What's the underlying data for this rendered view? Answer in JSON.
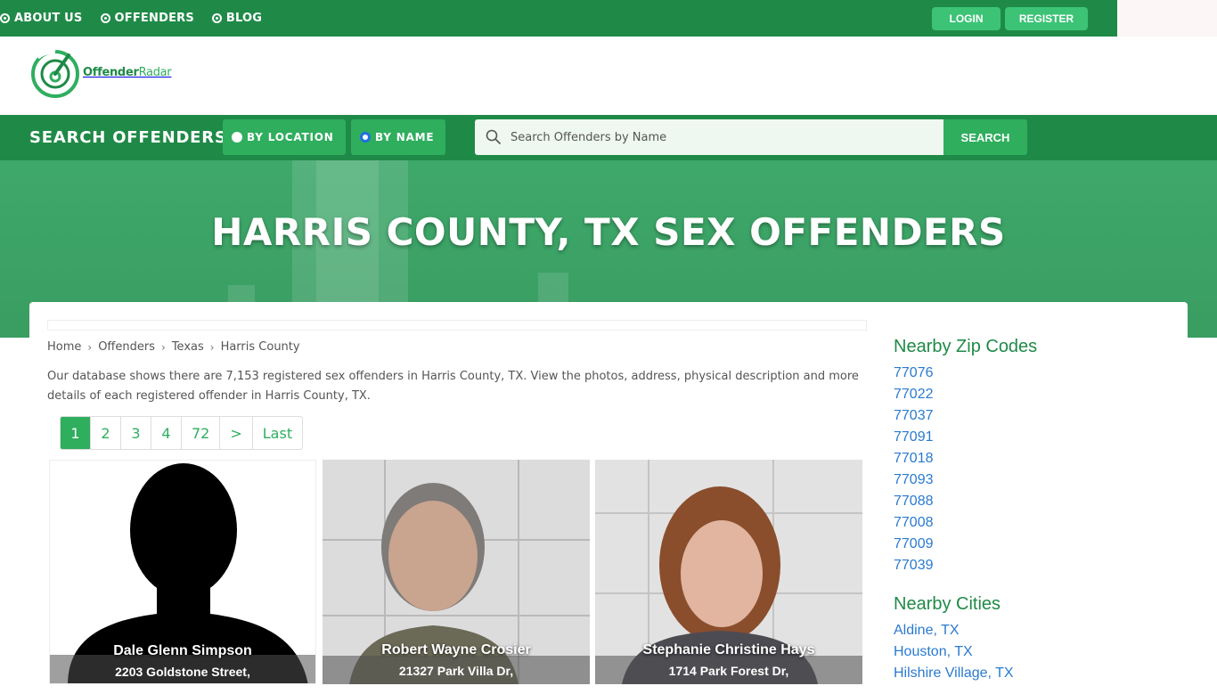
{
  "topnav": {
    "items": [
      {
        "label": "ABOUT US"
      },
      {
        "label": "OFFENDERS"
      },
      {
        "label": "BLOG"
      }
    ],
    "login_label": "LOGIN",
    "register_label": "REGISTER"
  },
  "logo": {
    "text_bold": "Offender",
    "text_light": "Radar"
  },
  "search": {
    "title": "SEARCH OFFENDERS",
    "by_location_label": "BY LOCATION",
    "by_name_label": "BY NAME",
    "selected_mode": "BY NAME",
    "placeholder": "Search Offenders by Name",
    "value": "",
    "button_label": "SEARCH"
  },
  "hero": {
    "title": "HARRIS COUNTY, TX SEX OFFENDERS"
  },
  "breadcrumb": [
    {
      "label": "Home"
    },
    {
      "label": "Offenders"
    },
    {
      "label": "Texas"
    },
    {
      "label": "Harris County"
    }
  ],
  "intro": "Our database shows there are 7,153 registered sex offenders in Harris County, TX. View the photos, address, physical description and more details of each registered offender in Harris County, TX.",
  "pagination": {
    "pages": [
      "1",
      "2",
      "3",
      "4",
      "72",
      ">",
      "Last"
    ],
    "current": "1"
  },
  "offenders": [
    {
      "name": "Dale Glenn Simpson",
      "address": "2203 Goldstone Street,"
    },
    {
      "name": "Robert Wayne Crosier",
      "address": "21327 Park Villa Dr,"
    },
    {
      "name": "Stephanie Christine Hays",
      "address": "1714 Park Forest Dr,"
    }
  ],
  "sidebar": {
    "zip_heading": "Nearby Zip Codes",
    "zips": [
      "77076",
      "77022",
      "77037",
      "77091",
      "77018",
      "77093",
      "77088",
      "77008",
      "77009",
      "77039"
    ],
    "cities_heading": "Nearby Cities",
    "cities": [
      "Aldine, TX",
      "Houston, TX",
      "Hilshire Village, TX"
    ]
  },
  "colors": {
    "brand_green": "#1f8a47",
    "accent_green": "#2fae5e",
    "link_blue": "#2a7ad0"
  }
}
